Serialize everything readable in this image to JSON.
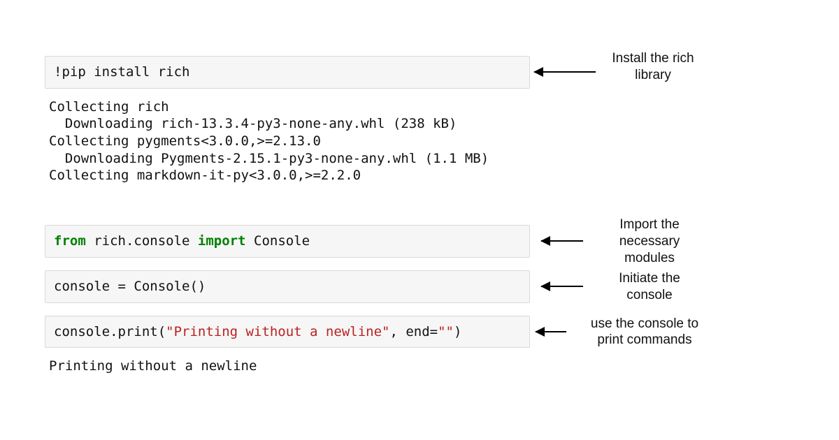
{
  "cells": {
    "install": {
      "bang": "!",
      "cmd": "pip install rich",
      "annotation": "Install the rich\nlibrary"
    },
    "install_output": {
      "text": "Collecting rich\n  Downloading rich-13.3.4-py3-none-any.whl (238 kB)\nCollecting pygments<3.0.0,>=2.13.0\n  Downloading Pygments-2.15.1-py3-none-any.whl (1.1 MB)\nCollecting markdown-it-py<3.0.0,>=2.2.0"
    },
    "import": {
      "kw_from": "from",
      "mod": " rich.console ",
      "kw_import": "import",
      "name": " Console",
      "annotation": "Import the\nnecessary\nmodules"
    },
    "init": {
      "text": "console = Console()",
      "annotation": "Initiate the\nconsole"
    },
    "print": {
      "pre": "console.print(",
      "str1": "\"Printing without a newline\"",
      "mid": ", end=",
      "str2": "\"\"",
      "post": ")",
      "annotation": "use the console to\nprint commands"
    },
    "print_output": {
      "text": "Printing without a newline"
    }
  }
}
